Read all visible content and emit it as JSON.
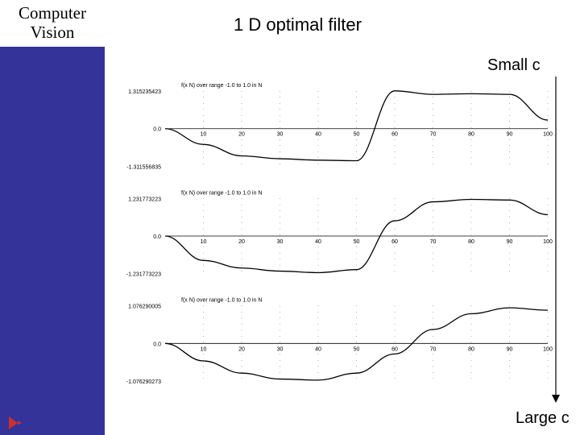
{
  "sidebar": {
    "line1": "Computer",
    "line2": "Vision"
  },
  "title": "1 D optimal filter",
  "labels": {
    "top": "Small c",
    "bottom": "Large c"
  },
  "chart_data": [
    {
      "type": "line",
      "title": "f(x N) over range -1.0 to 1.0 in N",
      "ylabel": "",
      "xlabel": "",
      "ylim": [
        -1.311556835,
        1.315235423
      ],
      "ymax_label": "1.315235423",
      "ymin_label": "-1.311556835",
      "yzero_label": "0.0",
      "x": [
        0,
        10,
        20,
        30,
        40,
        50,
        60,
        70,
        80,
        90,
        100
      ],
      "x_ticks": [
        10,
        20,
        30,
        40,
        50,
        60,
        70,
        80,
        90,
        100
      ],
      "values": [
        0,
        -0.55,
        -0.95,
        -1.05,
        -1.1,
        -1.12,
        1.32,
        1.2,
        1.22,
        1.2,
        0.3
      ]
    },
    {
      "type": "line",
      "title": "f(x N) over range -1.0 to 1.0 in N",
      "ylabel": "",
      "xlabel": "",
      "ylim": [
        -1.231773223,
        1.231773223
      ],
      "ymax_label": "1.231773223",
      "ymin_label": "-1.231773223",
      "yzero_label": "0.0",
      "x": [
        0,
        10,
        20,
        30,
        40,
        50,
        60,
        70,
        80,
        90,
        100
      ],
      "x_ticks": [
        10,
        20,
        30,
        40,
        50,
        60,
        70,
        80,
        90,
        100
      ],
      "values": [
        0,
        -0.8,
        -1.05,
        -1.15,
        -1.2,
        -1.1,
        0.5,
        1.12,
        1.2,
        1.18,
        0.7
      ]
    },
    {
      "type": "line",
      "title": "f(x N) over range -1.0 to 1.0 in N",
      "ylabel": "",
      "xlabel": "",
      "ylim": [
        -1.076290273,
        1.076290005
      ],
      "ymax_label": "1.076290005",
      "ymin_label": "-1.076290273",
      "yzero_label": "0.0",
      "x": [
        0,
        10,
        20,
        30,
        40,
        50,
        60,
        70,
        80,
        90,
        100
      ],
      "x_ticks": [
        10,
        20,
        30,
        40,
        50,
        60,
        70,
        80,
        90,
        100
      ],
      "values": [
        0,
        -0.5,
        -0.85,
        -1.02,
        -1.05,
        -0.85,
        -0.3,
        0.4,
        0.85,
        1.02,
        0.95
      ]
    }
  ]
}
